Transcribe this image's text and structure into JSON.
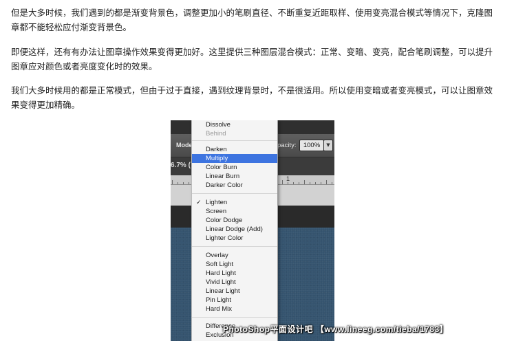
{
  "article": {
    "p1": "但是大多时候，我们遇到的都是渐变背景色，调整更加小的笔刷直径、不断重复近距取样、使用变亮混合模式等情况下，克隆图章都不能轻松应付渐变背景色。",
    "p2": "即便这样，还有有办法让图章操作效果变得更加好。这里提供三种图层混合模式：正常、变暗、变亮，配合笔刷调整，可以提升图章应对颜色或者亮度变化时的效果。",
    "p3": "我们大多时候用的都是正常模式，但由于过于直接，遇到纹理背景时，不是很适用。所以使用变暗或者变亮模式，可以让图章效果变得更加精确。"
  },
  "photoshop": {
    "mode_label": "Mode",
    "opacity_label": "pacity:",
    "opacity_value": "100%",
    "zoom_text": "6.7% (",
    "ruler_number": "1",
    "blend_menu": {
      "items": [
        {
          "label": "Dissolve"
        },
        {
          "label": "Behind",
          "disabled": true
        },
        {
          "label": "Darken"
        },
        {
          "label": "Multiply",
          "selected": true
        },
        {
          "label": "Color Burn"
        },
        {
          "label": "Linear Burn"
        },
        {
          "label": "Darker Color"
        },
        {
          "label": "Lighten",
          "checked": true
        },
        {
          "label": "Screen"
        },
        {
          "label": "Color Dodge"
        },
        {
          "label": "Linear Dodge (Add)"
        },
        {
          "label": "Lighter Color"
        },
        {
          "label": "Overlay"
        },
        {
          "label": "Soft Light"
        },
        {
          "label": "Hard Light"
        },
        {
          "label": "Vivid Light"
        },
        {
          "label": "Linear Light"
        },
        {
          "label": "Pin Light"
        },
        {
          "label": "Hard Mix"
        },
        {
          "label": "Difference"
        },
        {
          "label": "Exclusion"
        }
      ],
      "check_glyph": "✓"
    }
  },
  "watermark": "PhotoShop平面设计吧 【www.lineeg.com/tieba/1783】"
}
